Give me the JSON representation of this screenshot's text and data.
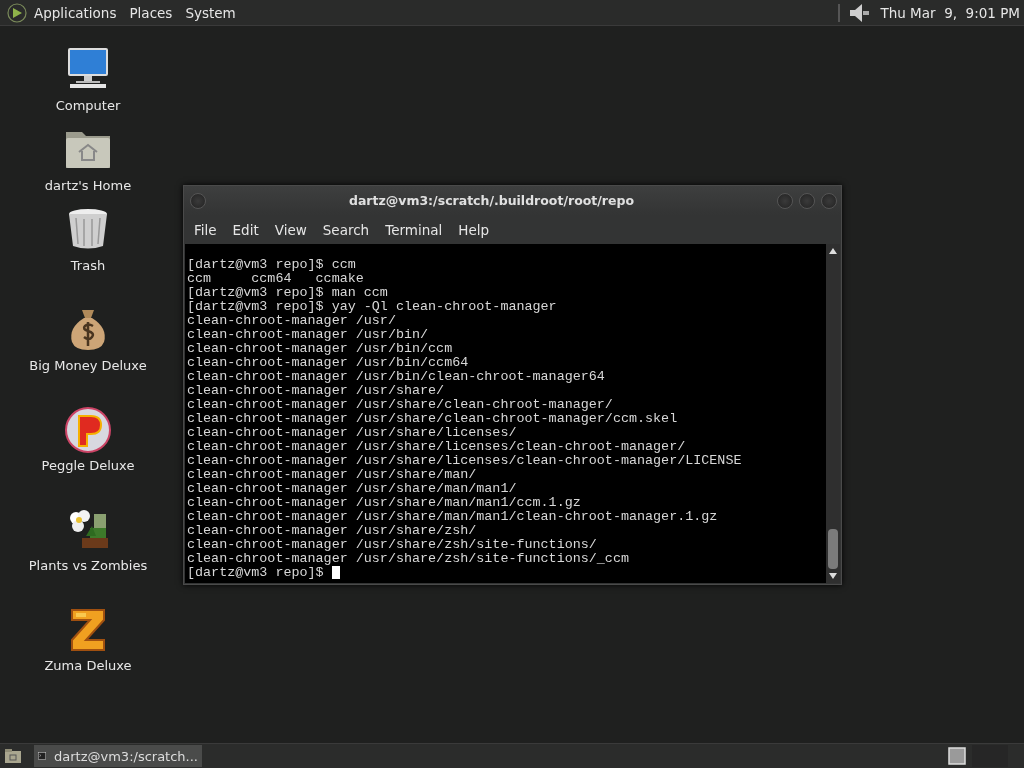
{
  "top_panel": {
    "menus": [
      "Applications",
      "Places",
      "System"
    ],
    "clock": "Thu Mar  9,  9:01 PM"
  },
  "desktop_icons": [
    {
      "kind": "computer",
      "label": "Computer"
    },
    {
      "kind": "home",
      "label": "dartz's Home"
    },
    {
      "kind": "trash",
      "label": "Trash"
    },
    {
      "kind": "money",
      "label": "Big Money Deluxe"
    },
    {
      "kind": "ball",
      "label": "Peggle Deluxe"
    },
    {
      "kind": "flower",
      "label": "Plants vs Zombies"
    },
    {
      "kind": "block",
      "label": "Zuma Deluxe"
    }
  ],
  "terminal_window": {
    "title": "dartz@vm3:/scratch/.buildroot/root/repo",
    "menu": [
      "File",
      "Edit",
      "View",
      "Search",
      "Terminal",
      "Help"
    ],
    "lines": [
      "[dartz@vm3 repo]$ ccm",
      "ccm     ccm64   ccmake",
      "[dartz@vm3 repo]$ man ccm",
      "[dartz@vm3 repo]$ yay -Ql clean-chroot-manager",
      "clean-chroot-manager /usr/",
      "clean-chroot-manager /usr/bin/",
      "clean-chroot-manager /usr/bin/ccm",
      "clean-chroot-manager /usr/bin/ccm64",
      "clean-chroot-manager /usr/bin/clean-chroot-manager64",
      "clean-chroot-manager /usr/share/",
      "clean-chroot-manager /usr/share/clean-chroot-manager/",
      "clean-chroot-manager /usr/share/clean-chroot-manager/ccm.skel",
      "clean-chroot-manager /usr/share/licenses/",
      "clean-chroot-manager /usr/share/licenses/clean-chroot-manager/",
      "clean-chroot-manager /usr/share/licenses/clean-chroot-manager/LICENSE",
      "clean-chroot-manager /usr/share/man/",
      "clean-chroot-manager /usr/share/man/man1/",
      "clean-chroot-manager /usr/share/man/man1/ccm.1.gz",
      "clean-chroot-manager /usr/share/man/man1/clean-chroot-manager.1.gz",
      "clean-chroot-manager /usr/share/zsh/",
      "clean-chroot-manager /usr/share/zsh/site-functions/",
      "clean-chroot-manager /usr/share/zsh/site-functions/_ccm"
    ],
    "prompt": "[dartz@vm3 repo]$ "
  },
  "taskbar": {
    "tasks": [
      {
        "label": "dartz@vm3:/scratch...",
        "selected": true
      }
    ]
  }
}
